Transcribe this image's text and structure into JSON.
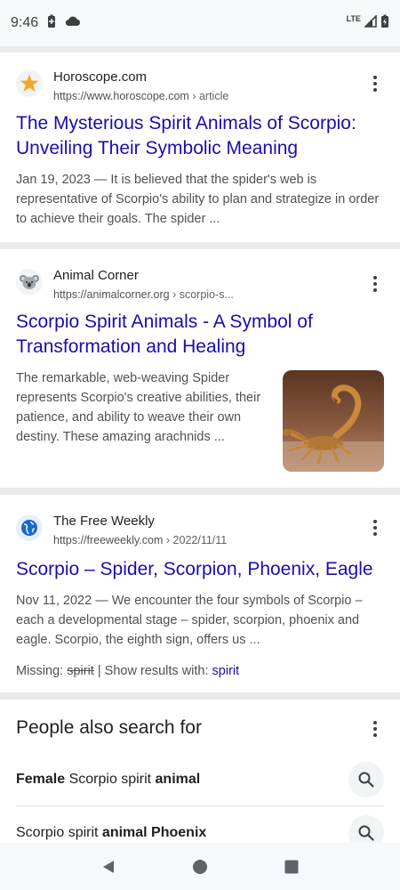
{
  "status": {
    "time": "9:46",
    "network": "LTE"
  },
  "results": [
    {
      "site_name": "Horoscope.com",
      "url": "https://www.horoscope.com",
      "path": " › article",
      "title": "The Mysterious Spirit Animals of Scorpio: Unveiling Their Symbolic Meaning",
      "snippet": "Jan 19, 2023 — It is believed that the spider's web is representative of Scorpio's ability to plan and strategize in order to achieve their goals. The spider ..."
    },
    {
      "site_name": "Animal Corner",
      "url": "https://animalcorner.org",
      "path": " › scorpio-s...",
      "title": "Scorpio Spirit Animals - A Symbol of Transformation and Healing",
      "snippet": "The remarkable, web-weaving Spider represents Scorpio's creative abilities, their patience, and ability to weave their own destiny. These amazing arachnids ..."
    },
    {
      "site_name": "The Free Weekly",
      "url": "https://freeweekly.com",
      "path": " › 2022/11/11",
      "title": "Scorpio – Spider, Scorpion, Phoenix, Eagle",
      "snippet": "Nov 11, 2022 — We encounter the four symbols of Scorpio – each a developmental stage – spider, scorpion, phoenix and eagle. Scorpio, the eighth sign, offers us ...",
      "missing_label": "Missing: ",
      "missing_word": "spirit",
      "show_label": " | Show results with: ",
      "show_link": "spirit"
    }
  ],
  "people_also_search": {
    "title": "People also search for",
    "items": [
      {
        "bold1": "Female",
        "normal": " Scorpio spirit ",
        "bold2": "animal"
      },
      {
        "bold1": "",
        "normal": "Scorpio spirit ",
        "bold2": "animal Phoenix"
      }
    ]
  }
}
